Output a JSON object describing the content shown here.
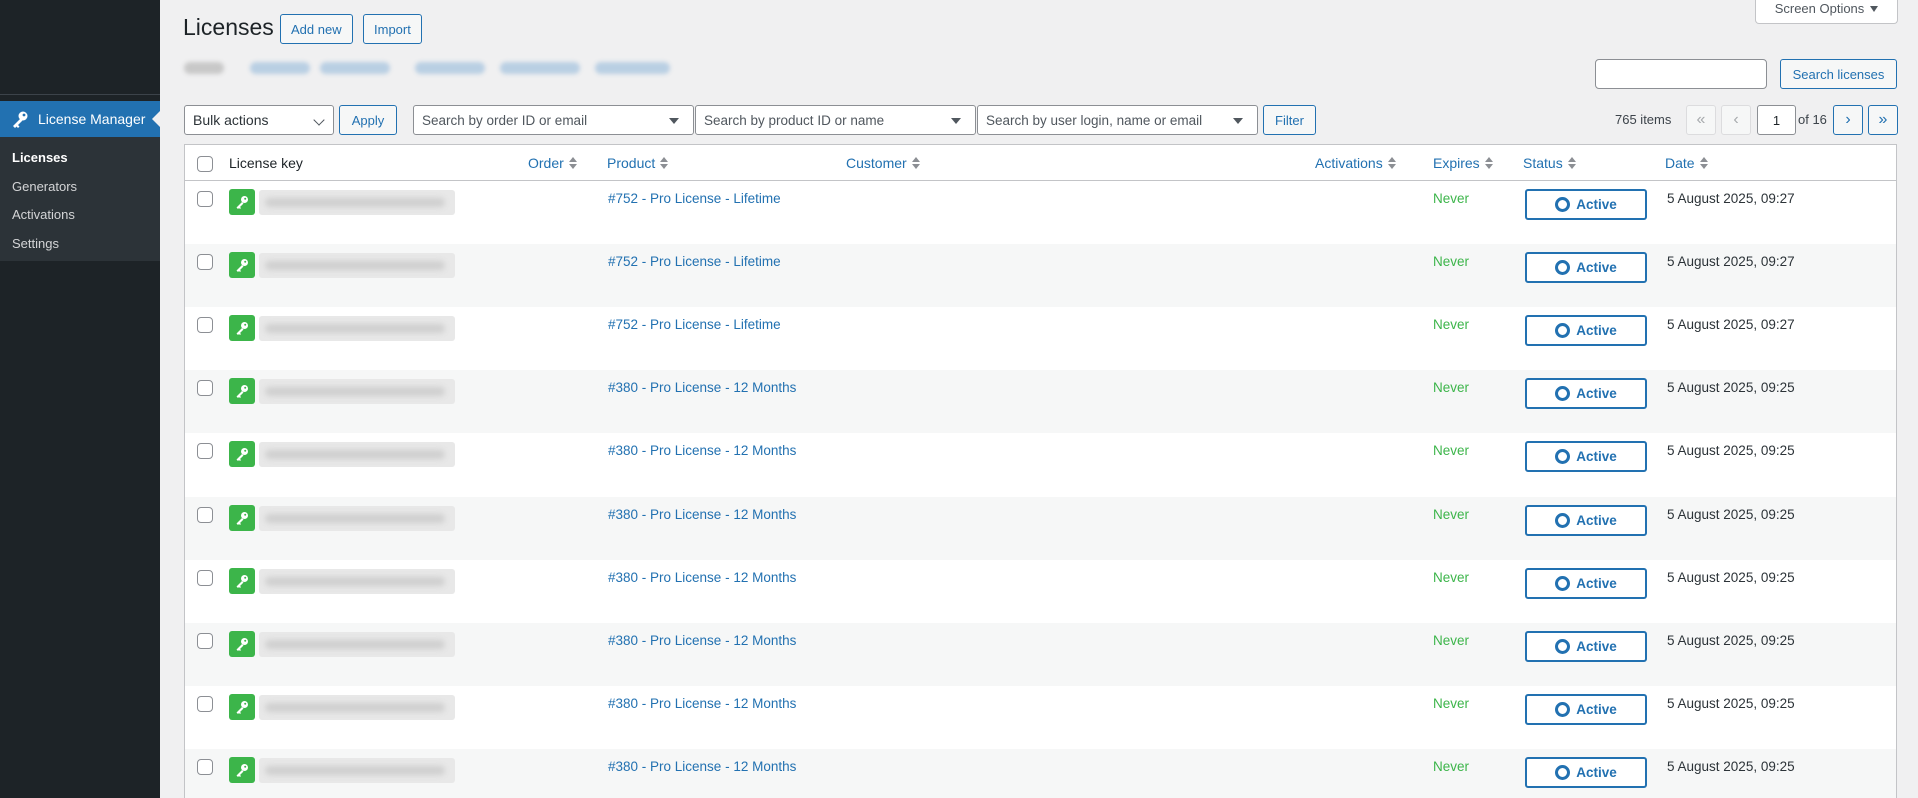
{
  "sidebar": {
    "active_menu": "License Manager",
    "submenu": [
      "Licenses",
      "Generators",
      "Activations",
      "Settings"
    ]
  },
  "header": {
    "title": "Licenses",
    "add_new": "Add new",
    "import": "Import",
    "screen_options": "Screen Options"
  },
  "search": {
    "button": "Search licenses",
    "value": ""
  },
  "tablenav": {
    "bulk_actions": "Bulk actions",
    "apply": "Apply",
    "order_placeholder": "Search by order ID or email",
    "product_placeholder": "Search by product ID or name",
    "user_placeholder": "Search by user login, name or email",
    "filter": "Filter",
    "items": "765 items",
    "page": "1",
    "of_pages": "of 16",
    "first": "«",
    "prev": "‹",
    "next": "›",
    "last": "»"
  },
  "table": {
    "columns": {
      "license_key": "License key",
      "order": "Order",
      "product": "Product",
      "customer": "Customer",
      "activations": "Activations",
      "expires": "Expires",
      "status": "Status",
      "date": "Date"
    },
    "rows": [
      {
        "product": "#752 - Pro License - Lifetime",
        "expires": "Never",
        "status": "Active",
        "date": "5 August 2025, 09:27"
      },
      {
        "product": "#752 - Pro License - Lifetime",
        "expires": "Never",
        "status": "Active",
        "date": "5 August 2025, 09:27"
      },
      {
        "product": "#752 - Pro License - Lifetime",
        "expires": "Never",
        "status": "Active",
        "date": "5 August 2025, 09:27"
      },
      {
        "product": "#380 - Pro License - 12 Months",
        "expires": "Never",
        "status": "Active",
        "date": "5 August 2025, 09:25"
      },
      {
        "product": "#380 - Pro License - 12 Months",
        "expires": "Never",
        "status": "Active",
        "date": "5 August 2025, 09:25"
      },
      {
        "product": "#380 - Pro License - 12 Months",
        "expires": "Never",
        "status": "Active",
        "date": "5 August 2025, 09:25"
      },
      {
        "product": "#380 - Pro License - 12 Months",
        "expires": "Never",
        "status": "Active",
        "date": "5 August 2025, 09:25"
      },
      {
        "product": "#380 - Pro License - 12 Months",
        "expires": "Never",
        "status": "Active",
        "date": "5 August 2025, 09:25"
      },
      {
        "product": "#380 - Pro License - 12 Months",
        "expires": "Never",
        "status": "Active",
        "date": "5 August 2025, 09:25"
      },
      {
        "product": "#380 - Pro License - 12 Months",
        "expires": "Never",
        "status": "Active",
        "date": "5 August 2025, 09:25"
      }
    ]
  },
  "colors": {
    "accent": "#2271b1",
    "sidebar_bg": "#1d2327",
    "never_green": "#3cb54a"
  }
}
